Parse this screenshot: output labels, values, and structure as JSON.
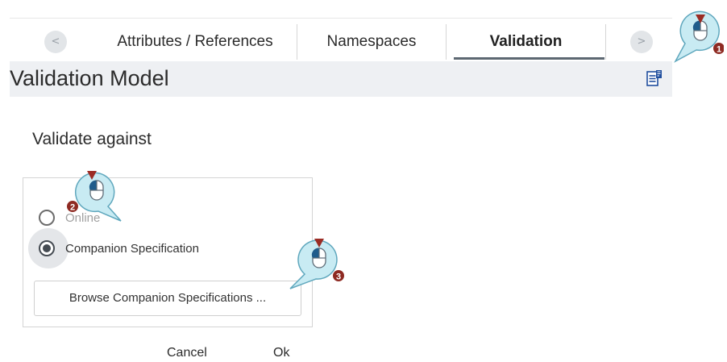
{
  "tabs": {
    "items": [
      {
        "label": "Attributes / References"
      },
      {
        "label": "Namespaces"
      },
      {
        "label": "Validation"
      }
    ],
    "active": "Validation",
    "prev_glyph": "<",
    "next_glyph": ">"
  },
  "model": {
    "title": "Validation Model"
  },
  "validate": {
    "title": "Validate against",
    "options": [
      {
        "label": "Online",
        "selected": false,
        "enabled": false
      },
      {
        "label": "Companion Specification",
        "selected": true,
        "enabled": true
      }
    ],
    "browse_label": "Browse Companion Specifications ..."
  },
  "footer": {
    "cancel": "Cancel",
    "ok": "Ok"
  },
  "callouts": [
    {
      "number": "1"
    },
    {
      "number": "2"
    },
    {
      "number": "3"
    }
  ],
  "colors": {
    "callout_fill": "#c8ebf3",
    "callout_stroke": "#5fa7bd",
    "arrow_red": "#9b2c24",
    "badge_red": "#8e2a22",
    "selected_tab_underline": "#5d6872"
  }
}
